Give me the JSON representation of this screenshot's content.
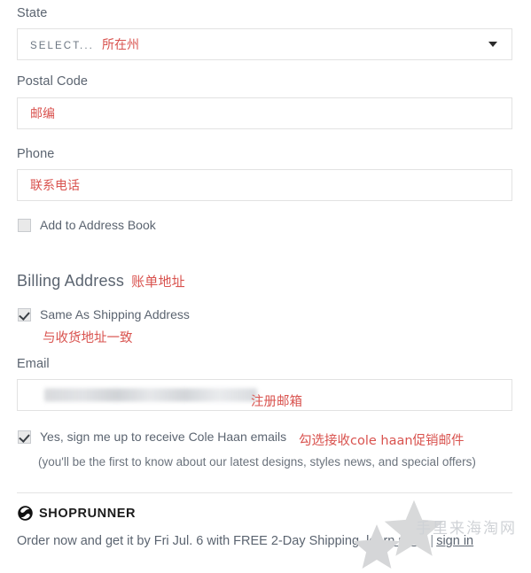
{
  "form": {
    "state": {
      "label": "State",
      "selected_value": "SELECT...",
      "annotation": "所在州",
      "caret_icon": "chevron-down-icon"
    },
    "postal_code": {
      "label": "Postal Code",
      "value": "",
      "annotation": "邮编"
    },
    "phone": {
      "label": "Phone",
      "value": "",
      "annotation": "联系电话"
    },
    "add_to_address_book": {
      "label": "Add to Address Book",
      "checked": false
    }
  },
  "billing": {
    "heading": "Billing Address",
    "heading_annotation": "账单地址",
    "same_as_shipping": {
      "label": "Same As Shipping Address",
      "checked": true,
      "annotation": "与收货地址一致"
    },
    "email": {
      "label": "Email",
      "value": "",
      "value_state": "redacted",
      "annotation": "注册邮箱"
    },
    "marketing_optin": {
      "label": "Yes, sign me up to receive Cole Haan emails",
      "checked": true,
      "annotation": "勾选接收cole haan促销邮件",
      "fine_print": "(you'll be the first to know about our latest designs, styles news, and special offers)"
    }
  },
  "shoprunner": {
    "logo_icon": "shoprunner-s-icon",
    "brand": "SHOPRUNNER",
    "message": "Order now and get it by Fri Jul. 6 with FREE 2-Day Shipping.",
    "learn_more": "learn more",
    "separator": "|",
    "sign_in": "sign in"
  },
  "watermark": {
    "text": "手里来海淘网",
    "star_icon": "star-icon"
  },
  "colors": {
    "annotation_red": "#d9534f",
    "label_gray": "#5b6470",
    "border_gray": "#e2e2e2",
    "watermark_gray": "#d8d9da"
  }
}
